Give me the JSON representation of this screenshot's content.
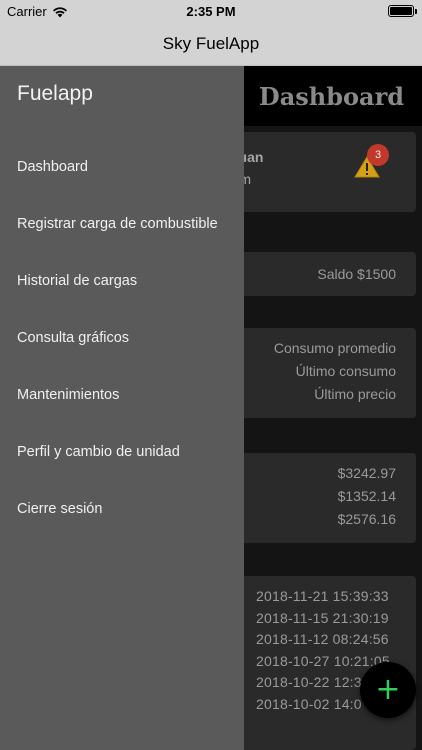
{
  "status_bar": {
    "carrier": "Carrier",
    "time": "2:35 PM",
    "battery_level": 1.0
  },
  "nav": {
    "title": "Sky FuelApp"
  },
  "dashboard": {
    "title": "Dashboard",
    "vehicle": {
      "name_partial": "guan",
      "km_partial": "Km",
      "alert_count": "3",
      "alert_icon": "warning-icon",
      "alert_color": "#d4a017",
      "badge_color": "#c0392b"
    },
    "saldo": "Saldo $1500",
    "consumo": {
      "promedio": "Consumo promedio",
      "ultimo": "Último consumo",
      "precio": "Último precio"
    },
    "gastos": [
      "$3242.97",
      "$1352.14",
      "$2576.16"
    ],
    "historial": [
      "2018-11-21 15:39:33",
      "2018-11-15 21:30:19",
      "2018-11-12 08:24:56",
      "2018-10-27 10:21:05",
      "2018-10-22 12:3",
      "2018-10-02 14:0"
    ]
  },
  "drawer": {
    "app_name": "Fuelapp",
    "items": [
      "Dashboard",
      "Registrar carga de combustible",
      "Historial de cargas",
      "Consulta gráficos",
      "Mantenimientos",
      "Perfil y cambio de unidad",
      "Cierre sesión"
    ]
  },
  "fab": {
    "icon": "plus-icon",
    "color": "#2fd05a"
  }
}
